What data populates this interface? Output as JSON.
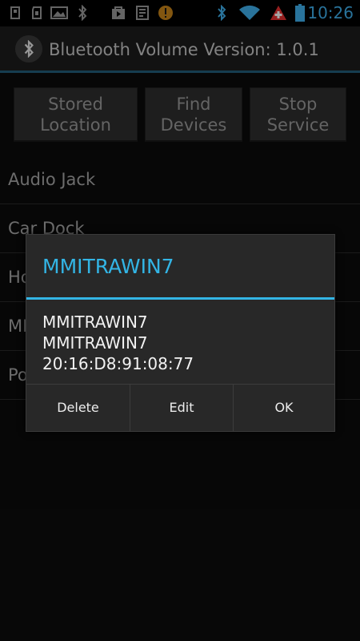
{
  "status_bar": {
    "time": "10:26",
    "colors": {
      "time": "#3fb1ee",
      "battery": "#3fb1ee",
      "warning": "#c8841a",
      "alert": "#e63131"
    },
    "icons": [
      "usb-icon",
      "sd-card-icon",
      "image-icon",
      "bluetooth-icon",
      "play-store-icon",
      "task-list-icon",
      "warning-icon",
      "bluetooth-connected-icon",
      "wifi-icon",
      "swiss-alert-icon",
      "battery-icon"
    ]
  },
  "action_bar": {
    "title": "Bluetooth Volume Version: 1.0.1",
    "icon": "bluetooth-app-icon",
    "divider_color": "#235f7c"
  },
  "buttons": [
    {
      "line1": "Stored",
      "line2": "Location"
    },
    {
      "line1": "Find",
      "line2": "Devices"
    },
    {
      "line1": "Stop",
      "line2": "Service"
    }
  ],
  "list": {
    "items": [
      {
        "label": "Audio Jack"
      },
      {
        "label": "Car Dock"
      },
      {
        "label": "Ho"
      },
      {
        "label": "MI"
      },
      {
        "label": "Po"
      }
    ]
  },
  "dialog": {
    "title": "MMITRAWIN7",
    "accent_color": "#33b5e5",
    "lines": [
      "MMITRAWIN7",
      "MMITRAWIN7",
      "20:16:D8:91:08:77"
    ],
    "buttons": {
      "delete": "Delete",
      "edit": "Edit",
      "ok": "OK"
    }
  }
}
